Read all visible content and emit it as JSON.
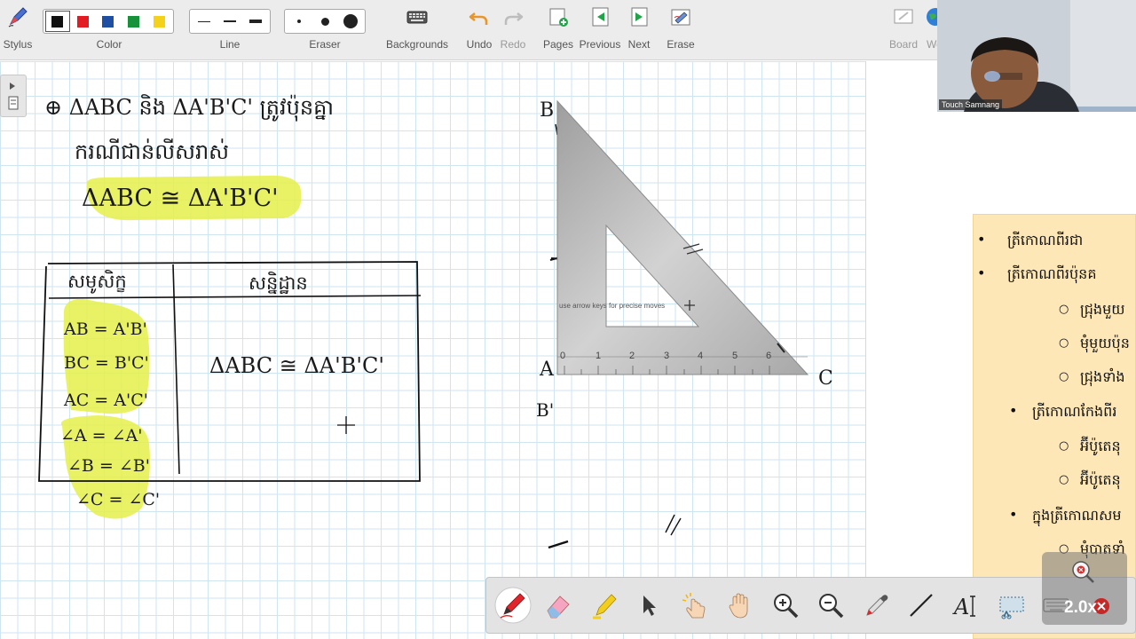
{
  "toolbar": {
    "stylus_label": "Stylus",
    "color_label": "Color",
    "line_label": "Line",
    "eraser_label": "Eraser",
    "backgrounds_label": "Backgrounds",
    "undo_label": "Undo",
    "redo_label": "Redo",
    "pages_label": "Pages",
    "previous_label": "Previous",
    "next_label": "Next",
    "erase_label": "Erase",
    "board_label": "Board",
    "web_label": "We",
    "colors": [
      "#111111",
      "#e31b23",
      "#1f4fa3",
      "#17923a",
      "#f4d21c"
    ],
    "selected_color_index": 1
  },
  "canvas": {
    "line1": "⊕ ΔABC និង ΔA'B'C' ត្រូវប៉ុនគ្នា",
    "line2": "ករណីជាន់លីសរាស់",
    "congruence_top": "ΔABC ≅ ΔA'B'C'",
    "table_header_left": "សមូសិក្ខ",
    "table_header_right": "សន្និដ្ឋាន",
    "table_rows": [
      "AB = A'B'",
      "BC = B'C'",
      "AC = A'C'",
      "∠A = ∠A'",
      "∠B = ∠B'",
      "∠C = ∠C'"
    ],
    "table_conclusion": "ΔABC ≅ ΔA'B'C'",
    "label_B": "B",
    "label_A": "A",
    "label_B_prime": "B'",
    "label_C": "C",
    "set_square_hint": "use arrow keys for precise moves",
    "ruler_ticks": [
      "0",
      "1",
      "2",
      "3",
      "4",
      "5",
      "6"
    ]
  },
  "webcam": {
    "name": "Touch Samnang"
  },
  "notes": {
    "items": [
      {
        "level": 1,
        "text": "ត្រីកោណពីរជា"
      },
      {
        "level": 1,
        "text": "ត្រីកោណពីរប៉ុនគ"
      },
      {
        "level": 2,
        "text": "ជ្រុងមួយ"
      },
      {
        "level": 2,
        "text": "មុំមួយប៉ុន"
      },
      {
        "level": 2,
        "text": "ជ្រុងទាំង"
      },
      {
        "level": 1,
        "text": "ត្រីកោណកែងពីរ"
      },
      {
        "level": 2,
        "text": "អ៊ីប៉ូតេនុ"
      },
      {
        "level": 2,
        "text": "អ៊ីប៉ូតេនុ"
      },
      {
        "level": 1,
        "text": "ក្នុងត្រីកោណសម"
      },
      {
        "level": 2,
        "text": "មុំបាតទាំ"
      }
    ]
  },
  "zoom": {
    "value": "2.0x"
  }
}
